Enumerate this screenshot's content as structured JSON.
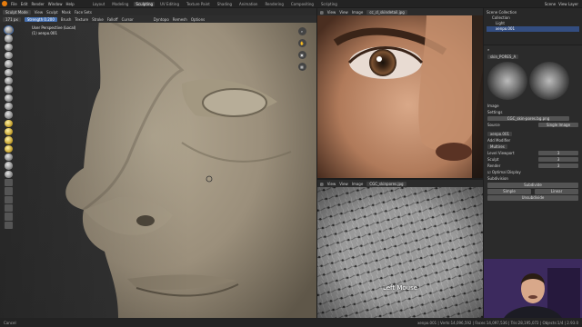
{
  "topbar": {
    "menus": [
      "File",
      "Edit",
      "Render",
      "Window",
      "Help"
    ],
    "workspaces": [
      "Layout",
      "Modeling",
      "Sculpting",
      "UV Editing",
      "Texture Paint",
      "Shading",
      "Animation",
      "Rendering",
      "Compositing",
      "Scripting"
    ],
    "active_workspace": "Sculpting",
    "scene_label": "Scene",
    "view_layer_label": "View Layer"
  },
  "viewport": {
    "mode": "Sculpt Mode",
    "header_items": [
      "View",
      "Sculpt",
      "Mask",
      "Face Sets"
    ],
    "brush_header": [
      "Brush",
      "Texture",
      "Stroke",
      "Falloff",
      "Cursor"
    ],
    "options": [
      "Dyntopo",
      "Remesh",
      "Options"
    ],
    "info_line1": "User Perspective (Local)",
    "info_line2": "(1) xenpo.001",
    "radius_value": "171 px",
    "strength_label": "Strength",
    "strength_value": "0.200"
  },
  "image_editor_top": {
    "menus": [
      "View",
      "View",
      "Image"
    ],
    "filename": "cc_cl_skindetail.jpg"
  },
  "image_editor_bottom": {
    "menus": [
      "View",
      "View",
      "Image"
    ],
    "filename": "CGC_skinpores.jpg",
    "overlay_text": "Left Mouse"
  },
  "outliner": {
    "title": "Scene Collection",
    "items": [
      "Collection",
      "Light",
      "xenpo.001"
    ]
  },
  "properties": {
    "texture_name": "skin_PORES_A",
    "image_section": "Image",
    "settings_section": "Settings",
    "image_file": "CGC_skin-pores.bg.png",
    "source_label": "Source",
    "source_value": "Single Image",
    "object_name": "xenpo.001",
    "add_modifier": "Add Modifier",
    "modifier_name": "Multires",
    "levels_viewport_label": "Level Viewport",
    "levels_viewport_value": "3",
    "sculpt_label": "Sculpt",
    "sculpt_value": "3",
    "render_label": "Render",
    "render_value": "3",
    "optimal_display": "Optimal Display",
    "subdivision_section": "Subdivision",
    "subdivide_btn": "Subdivide",
    "simple_btn": "Simple",
    "linear_btn": "Linear",
    "unsubdivide_btn": "Unsubdivide"
  },
  "statusbar": {
    "left": "Cancel",
    "right": "xenpo.001 | Verts:14,096,592 | Faces:14,097,536 | Tris:28,195,072 | Objects:1/4 | 2.93.0"
  },
  "colors": {
    "accent": "#4772b3",
    "blender_logo": "#e87d0d",
    "clay": "#9b8f7b"
  }
}
